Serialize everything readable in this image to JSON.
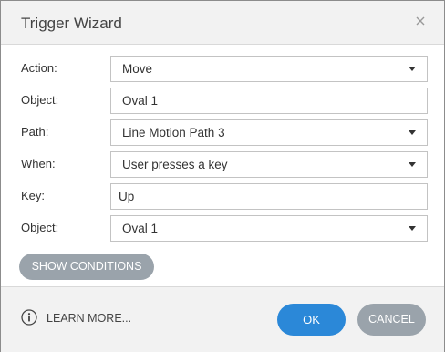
{
  "dialog": {
    "title": "Trigger Wizard",
    "close_icon": "close-icon"
  },
  "fields": {
    "action": {
      "label": "Action:",
      "value": "Move"
    },
    "object": {
      "label": "Object:",
      "value": "Oval 1"
    },
    "path": {
      "label": "Path:",
      "value": "Line Motion Path 3"
    },
    "when": {
      "label": "When:",
      "value": "User presses a key"
    },
    "key": {
      "label": "Key:",
      "value": "Up"
    },
    "object2": {
      "label": "Object:",
      "value": "Oval 1"
    }
  },
  "buttons": {
    "show_conditions": "SHOW CONDITIONS",
    "learn_more": "LEARN MORE...",
    "ok": "OK",
    "cancel": "CANCEL"
  },
  "colors": {
    "primary": "#2b88d8",
    "secondary": "#9aa3ab",
    "header_bg": "#f2f2f2"
  }
}
